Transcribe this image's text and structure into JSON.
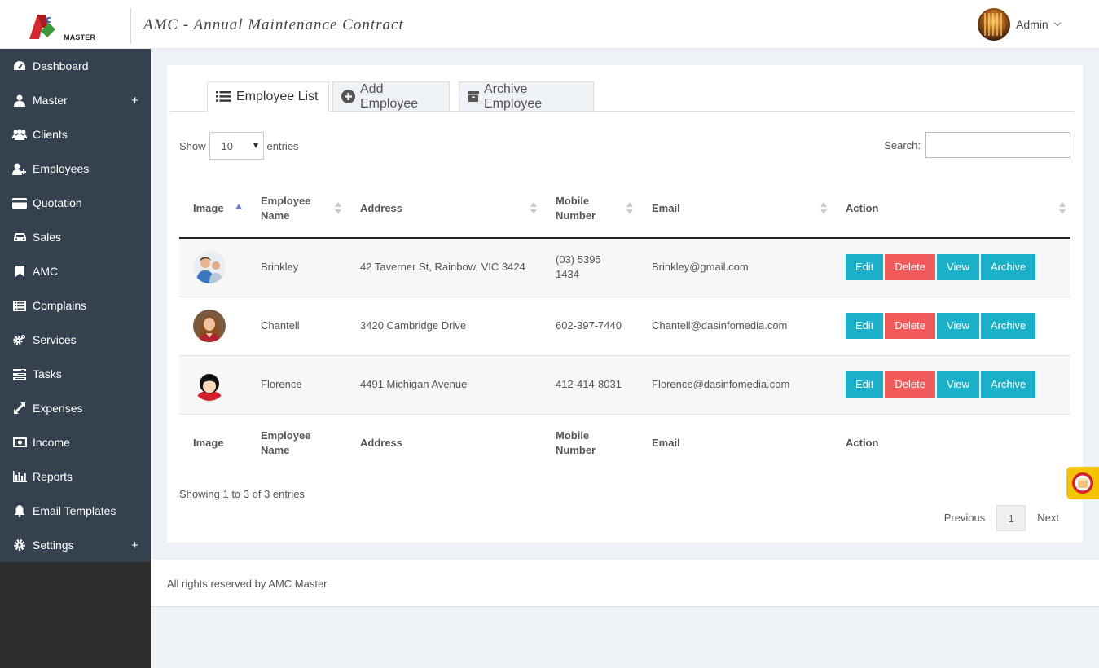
{
  "header": {
    "logo_text": "MASTER",
    "title": "AMC - Annual Maintenance Contract",
    "user_name": "Admin"
  },
  "sidebar": {
    "items": [
      {
        "label": "Dashboard",
        "icon": "dashboard-icon",
        "expand": ""
      },
      {
        "label": "Master",
        "icon": "user-icon",
        "expand": "+"
      },
      {
        "label": "Clients",
        "icon": "users-icon",
        "expand": ""
      },
      {
        "label": "Employees",
        "icon": "user-plus-icon",
        "expand": ""
      },
      {
        "label": "Quotation",
        "icon": "credit-card-icon",
        "expand": ""
      },
      {
        "label": "Sales",
        "icon": "car-icon",
        "expand": ""
      },
      {
        "label": "AMC",
        "icon": "bookmark-icon",
        "expand": ""
      },
      {
        "label": "Complains",
        "icon": "list-icon",
        "expand": ""
      },
      {
        "label": "Services",
        "icon": "cogs-icon",
        "expand": ""
      },
      {
        "label": "Tasks",
        "icon": "tasks-icon",
        "expand": ""
      },
      {
        "label": "Expenses",
        "icon": "expand-icon",
        "expand": ""
      },
      {
        "label": "Income",
        "icon": "money-icon",
        "expand": ""
      },
      {
        "label": "Reports",
        "icon": "bar-chart-icon",
        "expand": ""
      },
      {
        "label": "Email Templates",
        "icon": "bell-icon",
        "expand": ""
      },
      {
        "label": "Settings",
        "icon": "gear-icon",
        "expand": "+"
      }
    ]
  },
  "tabs": {
    "list": "Employee List",
    "add": "Add Employee",
    "archive": "Archive Employee"
  },
  "controls": {
    "show_label": "Show",
    "entries_value": "10",
    "entries_label": "entries",
    "search_label": "Search:",
    "search_value": ""
  },
  "table": {
    "headers": {
      "image": "Image",
      "name_1": "Employee",
      "name_2": "Name",
      "address": "Address",
      "mobile_1": "Mobile",
      "mobile_2": "Number",
      "email": "Email",
      "action": "Action"
    },
    "rows": [
      {
        "name": "Brinkley",
        "address": "42 Taverner St, Rainbow, VIC 3424",
        "mobile_1": "(03) 5395",
        "mobile_2": "1434",
        "email": "Brinkley@gmail.com"
      },
      {
        "name": "Chantell",
        "address": "3420 Cambridge Drive",
        "mobile_1": "602-397-7440",
        "mobile_2": "",
        "email": "Chantell@dasinfomedia.com"
      },
      {
        "name": "Florence",
        "address": "4491 Michigan Avenue",
        "mobile_1": "412-414-8031",
        "mobile_2": "",
        "email": "Florence@dasinfomedia.com"
      }
    ],
    "actions": {
      "edit": "Edit",
      "delete": "Delete",
      "view": "View",
      "archive": "Archive"
    }
  },
  "pagination": {
    "info": "Showing 1 to 3 of 3 entries",
    "previous": "Previous",
    "current": "1",
    "next": "Next"
  },
  "footer": {
    "text": "All rights reserved by AMC Master"
  },
  "colors": {
    "sidebar": "#364150",
    "info_button": "#1ab0c9",
    "danger_button": "#f05a5a",
    "widget": "#f5c400"
  }
}
